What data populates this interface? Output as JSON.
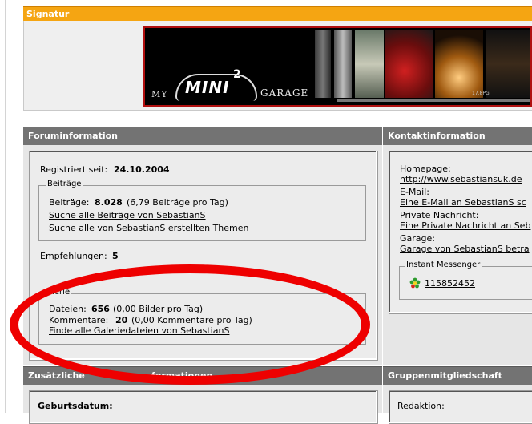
{
  "signature": {
    "header": "Signatur",
    "banner": {
      "my": "MY",
      "mini": "MINI",
      "sup": "2",
      "garage": "GARAGE",
      "caption": "17.8PG"
    }
  },
  "forum": {
    "header": "Foruminformation",
    "registered_label": "Registriert seit:",
    "registered_value": "24.10.2004",
    "posts_legend": "Beiträge",
    "posts_label": "Beiträge:",
    "posts_count": "8.028",
    "posts_rate": "(6,79 Beiträge pro Tag)",
    "posts_link1": "Suche alle Beiträge von SebastianS",
    "posts_link2": "Suche alle von SebastianS erstellten Themen",
    "recommend_label": "Empfehlungen:",
    "recommend_value": "5",
    "gallery_legend": "alerie",
    "files_label": "Dateien:",
    "files_count": "656",
    "files_rate": "(0,00 Bilder pro Tag)",
    "comments_label": "Kommentare:",
    "comments_count": "20",
    "comments_rate": "(0,00 Kommentare pro Tag)",
    "gallery_link": "Finde alle Galeriedateien von SebastianS"
  },
  "contact": {
    "header": "Kontaktinformation",
    "homepage_label": "Homepage:",
    "homepage_link": "http://www.sebastiansuk.de",
    "email_label": "E-Mail:",
    "email_link": "Eine E-Mail an SebastianS sc",
    "pm_label": "Private Nachricht:",
    "pm_link": "Eine Private Nachricht an Seb",
    "garage_label": "Garage:",
    "garage_link": "Garage von SebastianS betra",
    "im_legend": "Instant Messenger",
    "icq_number": "115852452"
  },
  "additional": {
    "header_left": "Zusätzliche",
    "header_right": "formationen",
    "birthday_label": "Geburtsdatum:"
  },
  "groups": {
    "header": "Gruppenmitgliedschaft",
    "redaktion_label": "Redaktion:"
  },
  "colors": {
    "signature_header": "#f5a512",
    "section_header": "#737373",
    "annotation": "#ee0000"
  }
}
